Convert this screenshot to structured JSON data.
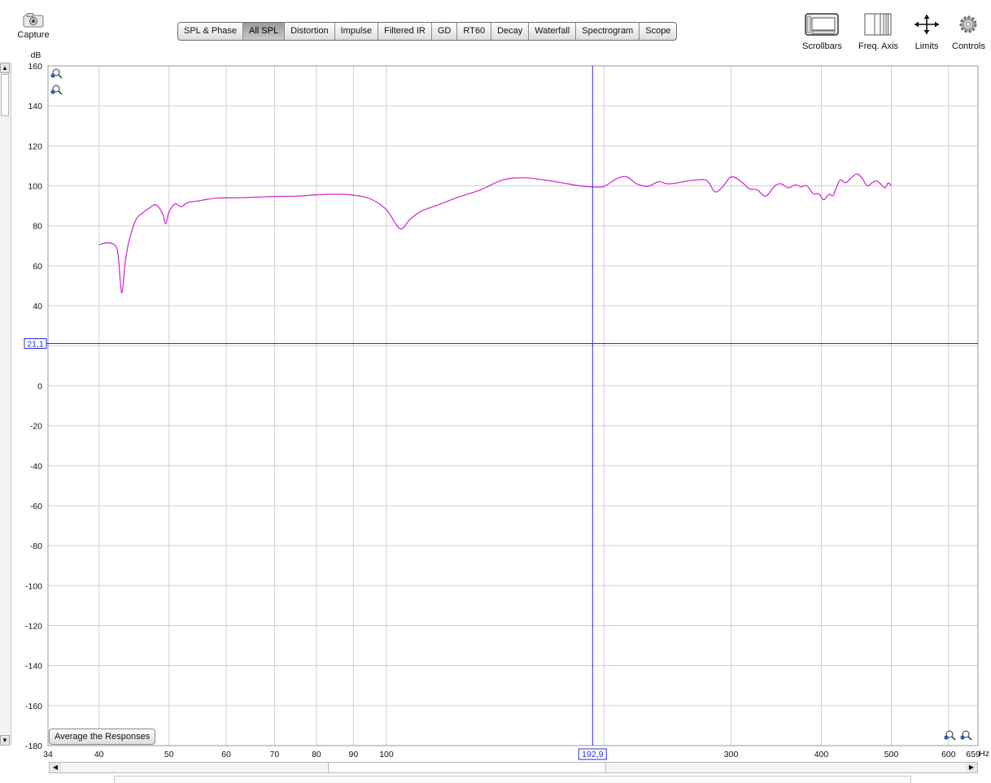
{
  "toolbar": {
    "capture_label": "Capture",
    "tabs": [
      {
        "label": "SPL & Phase",
        "active": false
      },
      {
        "label": "All SPL",
        "active": true
      },
      {
        "label": "Distortion",
        "active": false
      },
      {
        "label": "Impulse",
        "active": false
      },
      {
        "label": "Filtered IR",
        "active": false
      },
      {
        "label": "GD",
        "active": false
      },
      {
        "label": "RT60",
        "active": false
      },
      {
        "label": "Decay",
        "active": false
      },
      {
        "label": "Waterfall",
        "active": false
      },
      {
        "label": "Spectrogram",
        "active": false
      },
      {
        "label": "Scope",
        "active": false
      }
    ],
    "scrollbars_label": "Scrollbars",
    "freq_axis_label": "Freq. Axis",
    "limits_label": "Limits",
    "controls_label": "Controls"
  },
  "plot": {
    "y_unit": "dB",
    "x_unit": "Hz",
    "cursor_y_readout": "21,1",
    "cursor_x_readout": "192,9",
    "average_button_label": "Average the Responses"
  },
  "chart_data": {
    "type": "line",
    "x_scale": "log",
    "xlim": [
      34,
      659
    ],
    "ylim": [
      -180,
      160
    ],
    "xticks": [
      34,
      40,
      50,
      60,
      70,
      80,
      90,
      100,
      200,
      300,
      400,
      500,
      600,
      659
    ],
    "xtick_labels": [
      "34",
      "40",
      "50",
      "60",
      "70",
      "80",
      "90",
      "100",
      "",
      "300",
      "400",
      "500",
      "600",
      "659"
    ],
    "yticks": [
      160,
      140,
      120,
      100,
      80,
      60,
      40,
      20,
      0,
      -20,
      -40,
      -60,
      -80,
      -100,
      -120,
      -140,
      -160,
      -180
    ],
    "ytick_labels": [
      "160",
      "140",
      "120",
      "100",
      "80",
      "60",
      "40",
      "",
      "0",
      "-20",
      "-40",
      "-60",
      "-80",
      "-100",
      "-120",
      "-140",
      "-160",
      "-180"
    ],
    "grid": true,
    "cursor": {
      "x": 192.9,
      "y": 21.1
    },
    "series": [
      {
        "color": "#cc22cc",
        "x": [
          40,
          41,
          42,
          42.5,
          43,
          43.5,
          44,
          45,
          46,
          47,
          48,
          49,
          49.5,
          50,
          51,
          52,
          53,
          55,
          58,
          62,
          66,
          70,
          75,
          80,
          85,
          90,
          95,
          100,
          103,
          105,
          108,
          112,
          118,
          125,
          135,
          145,
          155,
          165,
          175,
          185,
          192,
          200,
          208,
          215,
          222,
          230,
          238,
          245,
          253,
          262,
          270,
          278,
          285,
          292,
          300,
          310,
          318,
          326,
          335,
          345,
          352,
          360,
          368,
          375,
          382,
          390,
          397,
          403,
          410,
          415,
          420,
          425,
          432,
          440,
          448,
          455,
          463,
          470,
          477,
          483,
          490,
          495,
          500
        ],
        "y": [
          70.5,
          71.5,
          70.5,
          66,
          46.5,
          62,
          72,
          83,
          86.5,
          89,
          90.5,
          86,
          81,
          87,
          91,
          89.5,
          91.5,
          92.5,
          93.8,
          94,
          94.3,
          94.7,
          94.8,
          95.5,
          95.8,
          95.3,
          93.5,
          88,
          81,
          78.5,
          83.5,
          87.5,
          90.5,
          94,
          98,
          103,
          104,
          103,
          101.5,
          100,
          99.5,
          99.7,
          103.5,
          104.5,
          101,
          99.7,
          102,
          101,
          101.5,
          102.5,
          103,
          102.5,
          97,
          99.5,
          104.5,
          102,
          98.5,
          98,
          94.8,
          100,
          101,
          99,
          100.5,
          99.5,
          100,
          96,
          96,
          93,
          95.8,
          95,
          99.5,
          103,
          101.5,
          104,
          106,
          104,
          100,
          101.5,
          102.5,
          101,
          99,
          101.5,
          100
        ]
      }
    ]
  }
}
